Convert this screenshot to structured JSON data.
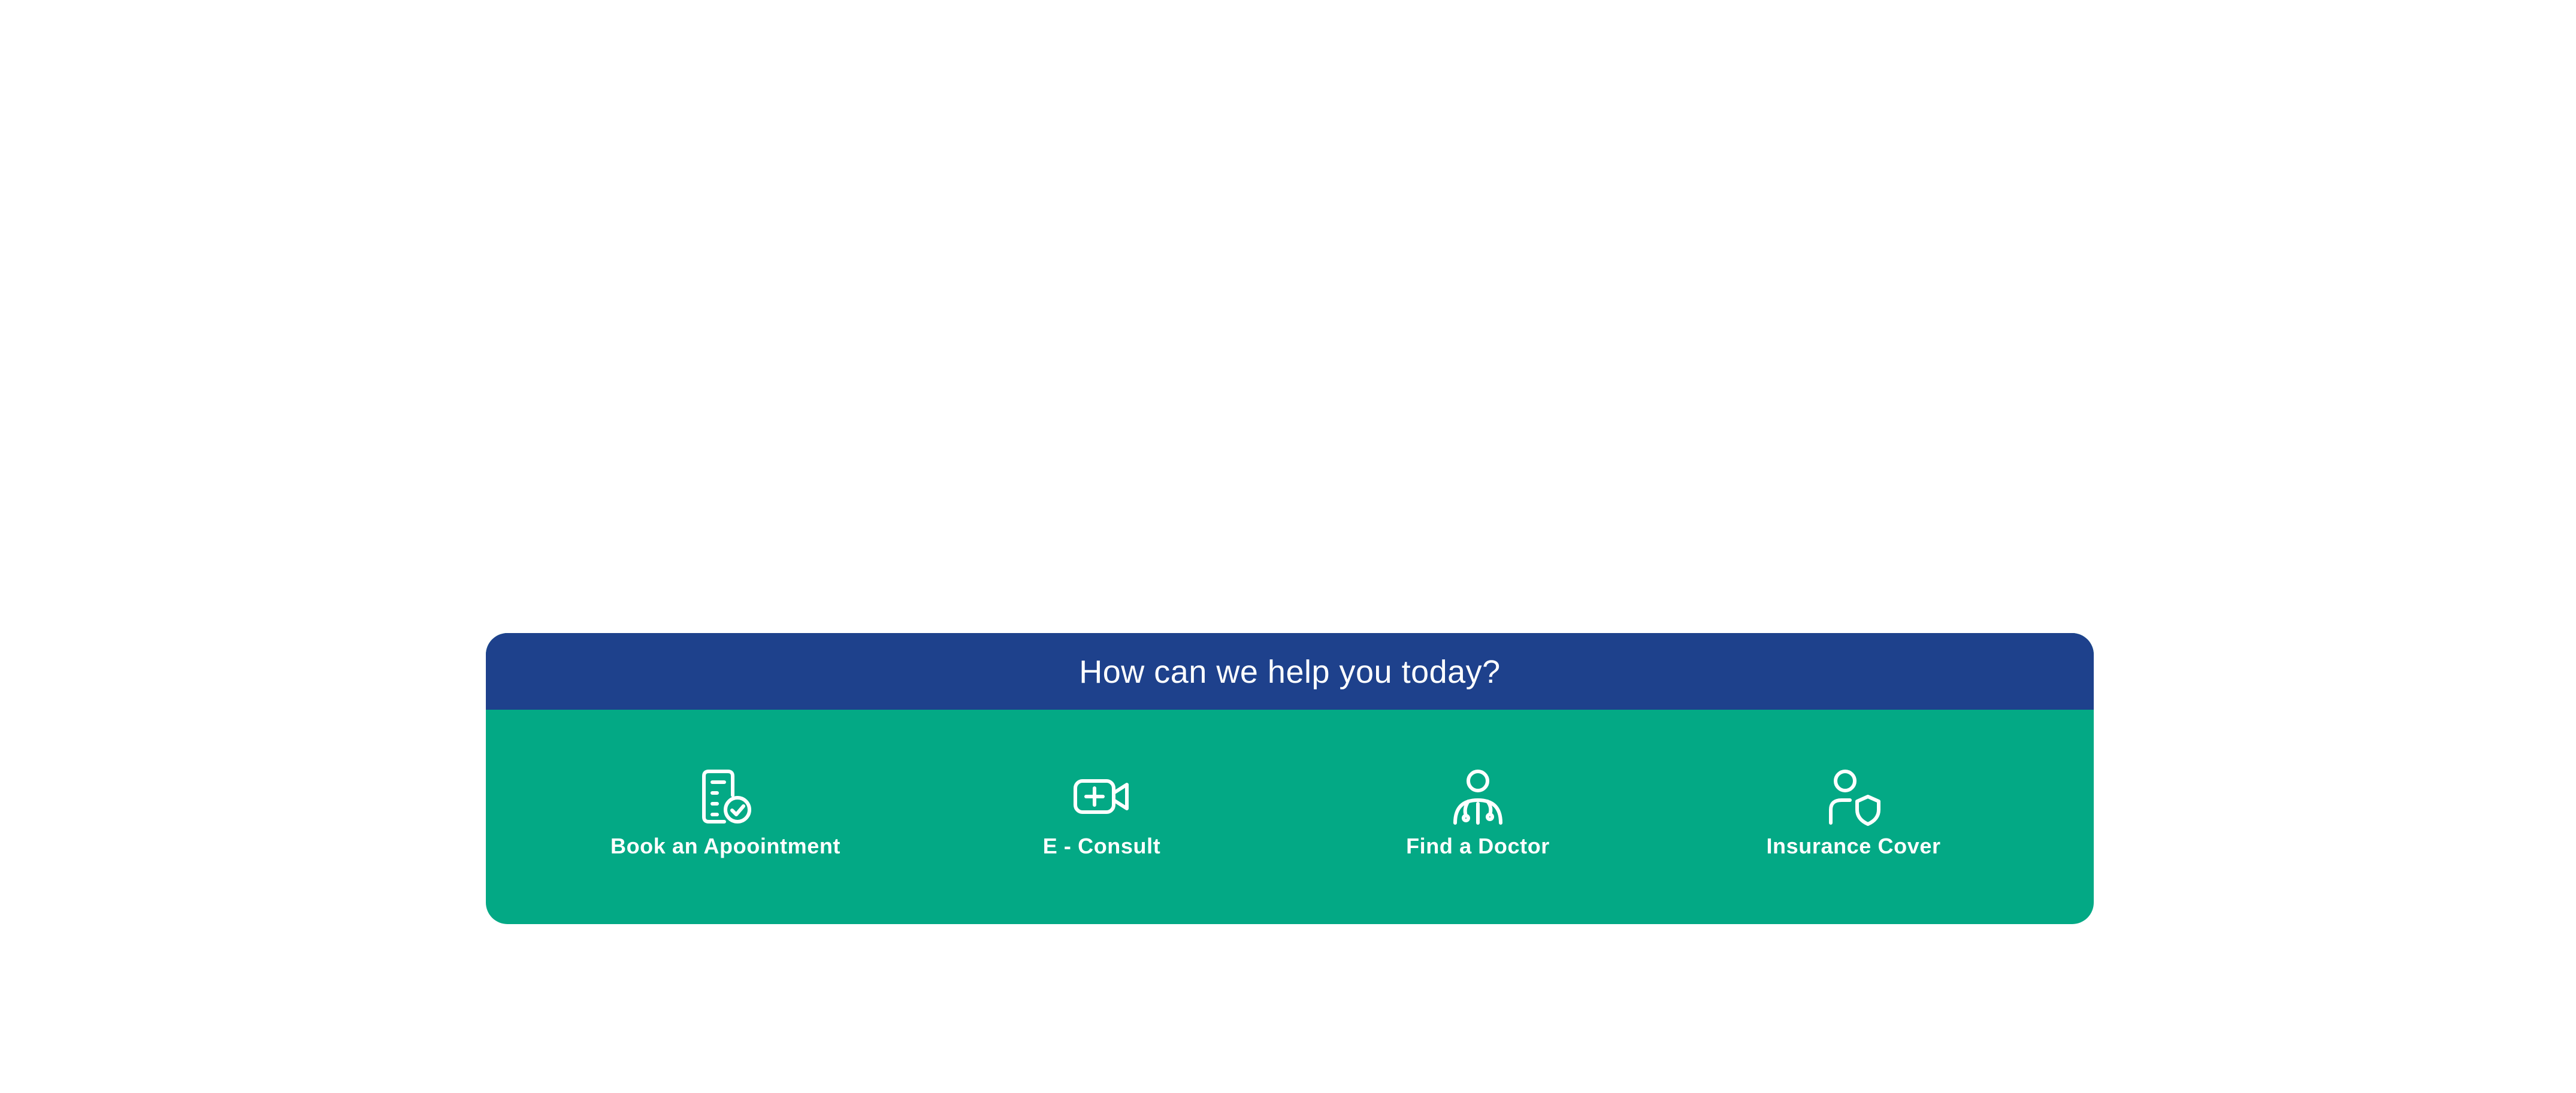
{
  "colors": {
    "header_bg": "#1e418c",
    "body_bg": "#03a985",
    "text": "#ffffff",
    "page_bg": "#ffffff"
  },
  "help": {
    "title": "How can we help you today?",
    "actions": [
      {
        "label": "Book an Apoointment",
        "icon": "appointment-document-check-icon"
      },
      {
        "label": "E - Consult",
        "icon": "video-camera-plus-icon"
      },
      {
        "label": "Find a Doctor",
        "icon": "doctor-stethoscope-icon"
      },
      {
        "label": "Insurance Cover",
        "icon": "user-shield-icon"
      }
    ]
  }
}
